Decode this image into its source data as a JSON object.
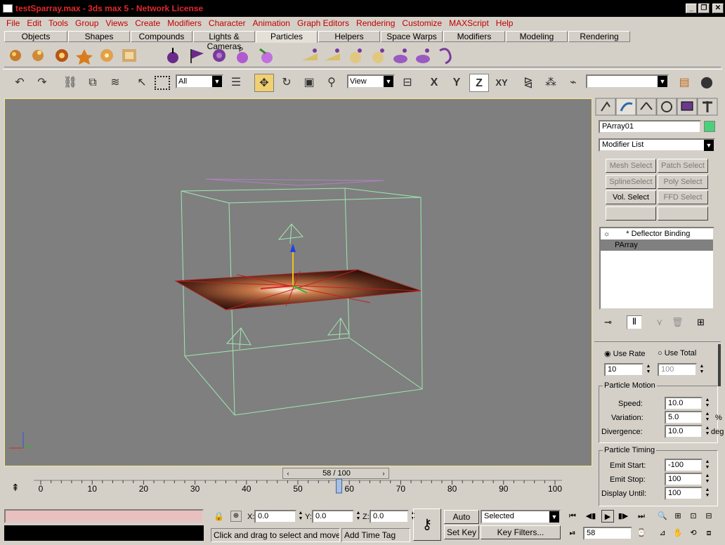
{
  "window": {
    "title": "testSparray.max - 3ds max 5 - Network License",
    "minimize": "_",
    "restore": "❐",
    "close": "✕"
  },
  "menu": [
    "File",
    "Edit",
    "Tools",
    "Group",
    "Views",
    "Create",
    "Modifiers",
    "Character",
    "Animation",
    "Graph Editors",
    "Rendering",
    "Customize",
    "MAXScript",
    "Help"
  ],
  "tabs": [
    "Objects",
    "Shapes",
    "Compounds",
    "Lights & Cameras",
    "Particles",
    "Helpers",
    "Space Warps",
    "Modifiers",
    "Modeling",
    "Rendering"
  ],
  "active_tab": "Particles",
  "toolbar": {
    "selection_filter": "All",
    "reference_coord": "View",
    "axis_x": "X",
    "axis_y": "Y",
    "axis_z": "Z",
    "axis_xy": "XY",
    "named_selection": ""
  },
  "panel": {
    "object_name": "PArray01",
    "object_color": "#4ad07a",
    "modifier_list": "Modifier List",
    "buttons": [
      "Mesh Select",
      "Patch Select",
      "SplineSelect",
      "Poly Select",
      "Vol. Select",
      "FFD Select",
      "",
      ""
    ],
    "stack": [
      "* Deflector Binding",
      "PArray"
    ],
    "use_rate": "Use Rate",
    "use_total": "Use Total",
    "rate_value": "10",
    "total_value": "100",
    "particle_motion": {
      "title": "Particle Motion",
      "speed_label": "Speed:",
      "speed": "10.0",
      "variation_label": "Variation:",
      "variation": "5.0",
      "variation_unit": "%",
      "divergence_label": "Divergence:",
      "divergence": "10.0",
      "divergence_unit": "deg"
    },
    "particle_timing": {
      "title": "Particle Timing",
      "emit_start_label": "Emit Start:",
      "emit_start": "-100",
      "emit_stop_label": "Emit Stop:",
      "emit_stop": "100",
      "display_until_label": "Display Until:",
      "display_until": "100"
    }
  },
  "timeline": {
    "slider_label": "58 / 100",
    "frame_fraction": 0.58,
    "ticks": [
      "0",
      "10",
      "20",
      "30",
      "40",
      "50",
      "60",
      "70",
      "80",
      "90",
      "100"
    ]
  },
  "status": {
    "x_label": "X:",
    "x": "0.0",
    "y_label": "Y:",
    "y": "0.0",
    "z_label": "Z:",
    "z": "0.0",
    "prompt": "Click and drag to select and move obj",
    "add_time_tag": "Add Time Tag",
    "auto_key": "Auto Key",
    "set_key": "Set Key",
    "selected": "Selected",
    "key_filters": "Key Filters...",
    "current_frame": "58"
  }
}
